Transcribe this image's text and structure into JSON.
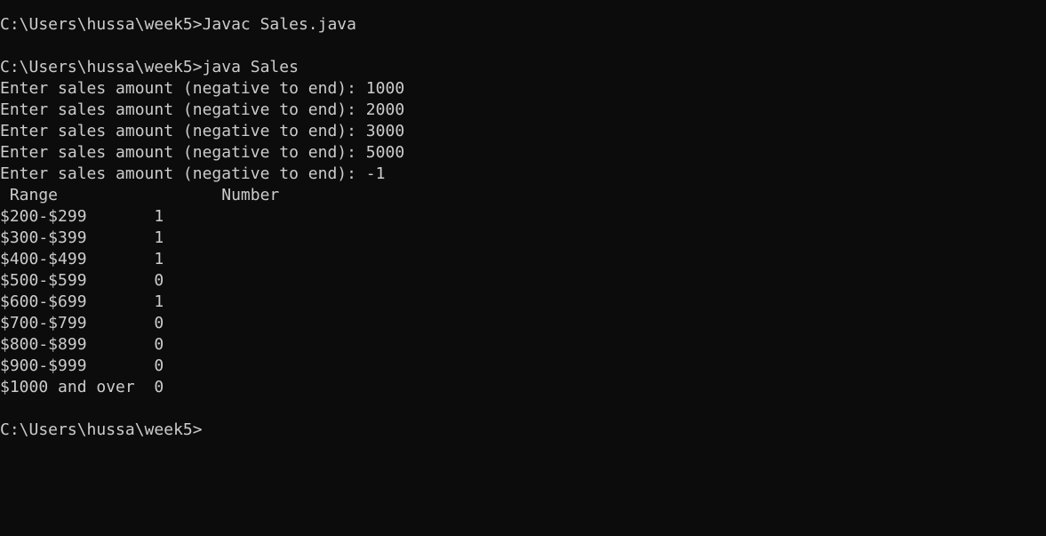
{
  "console": {
    "background": "#0c0c0c",
    "foreground": "#cccccc",
    "lines": [
      "C:\\Users\\hussa\\week5>Javac Sales.java",
      "",
      "C:\\Users\\hussa\\week5>java Sales",
      "Enter sales amount (negative to end): 1000",
      "Enter sales amount (negative to end): 2000",
      "Enter sales amount (negative to end): 3000",
      "Enter sales amount (negative to end): 5000",
      "Enter sales amount (negative to end): -1",
      " Range                 Number",
      "$200-$299       1",
      "$300-$399       1",
      "$400-$499       1",
      "$500-$599       0",
      "$600-$699       1",
      "$700-$799       0",
      "$800-$899       0",
      "$900-$999       0",
      "$1000 and over  0",
      "",
      "C:\\Users\\hussa\\week5>"
    ]
  }
}
